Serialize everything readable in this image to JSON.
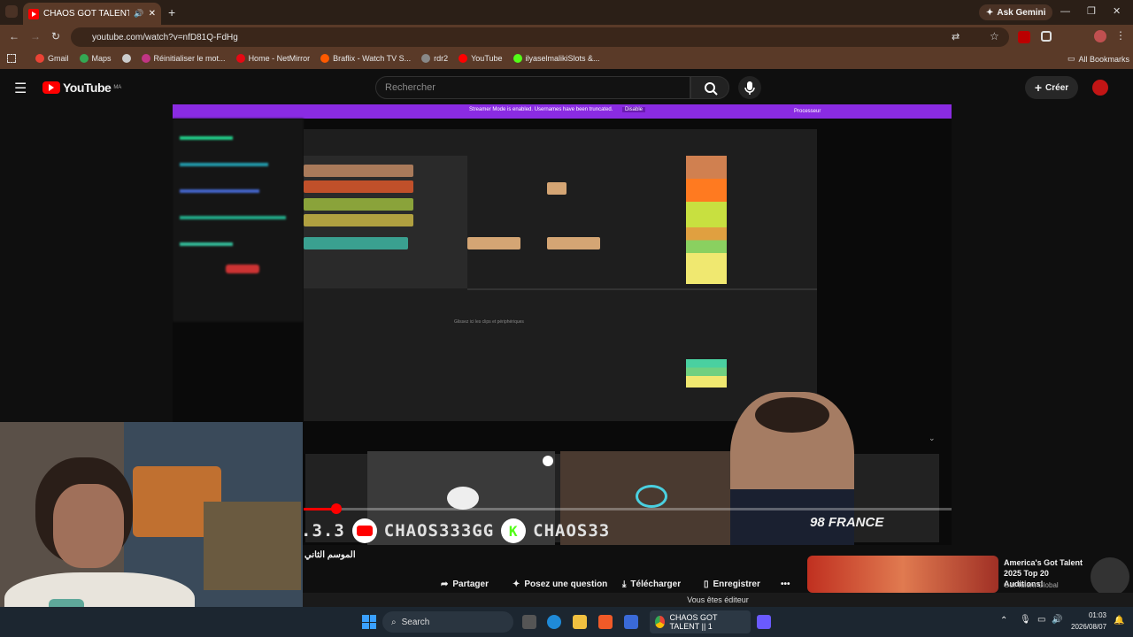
{
  "browser": {
    "tab_title": "CHAOS GOT TALENT ||",
    "url": "youtube.com/watch?v=nfD81Q-FdHg",
    "ask_gemini": "Ask Gemini",
    "bookmarks": [
      {
        "label": "Gmail",
        "color": "#ea4335"
      },
      {
        "label": "Maps",
        "color": "#34a853"
      },
      {
        "label": "",
        "color": "#cccccc"
      },
      {
        "label": "Réinitialiser le mot...",
        "color": "#c13584"
      },
      {
        "label": "Home - NetMirror",
        "color": "#e50914"
      },
      {
        "label": "Braflix - Watch TV S...",
        "color": "#ff5a00"
      },
      {
        "label": "rdr2",
        "color": "#888888"
      },
      {
        "label": "YouTube",
        "color": "#ff0000"
      },
      {
        "label": "ilyaselmalikiSlots &...",
        "color": "#53fc18"
      }
    ],
    "all_bookmarks": "All Bookmarks"
  },
  "youtube": {
    "logo": "YouTube",
    "logo_region": "MA",
    "search_placeholder": "Rechercher",
    "create_label": "Créer"
  },
  "video": {
    "streamer_mode_text": "Streamer Mode is enabled. Usernames have been truncated.",
    "disable_label": "Disable",
    "daw_status": "Processeur",
    "daw_hint": "Glissez ici les clips et périphériques",
    "banner_left": ".3.3",
    "banner_youtube_handle": "CHAOS333GG",
    "banner_kick_handle": "CHAOS33",
    "channel_logo": "98 FRANCE",
    "progress_percent": 4
  },
  "below_video": {
    "arabic_caption": "الموسم الثاني",
    "share": "Partager",
    "ask": "Posez une question",
    "download": "Télécharger",
    "save": "Enregistrer",
    "editor_status": "Vous êtes éditeur",
    "suggested_title": "America's Got Talent 2025 Top 20 Auditions!",
    "suggested_channel": "Got Talent Global"
  },
  "taskbar": {
    "search": "Search",
    "chrome_title": "CHAOS GOT TALENT || 1",
    "time": "01:03",
    "date": "2026/08/07"
  }
}
